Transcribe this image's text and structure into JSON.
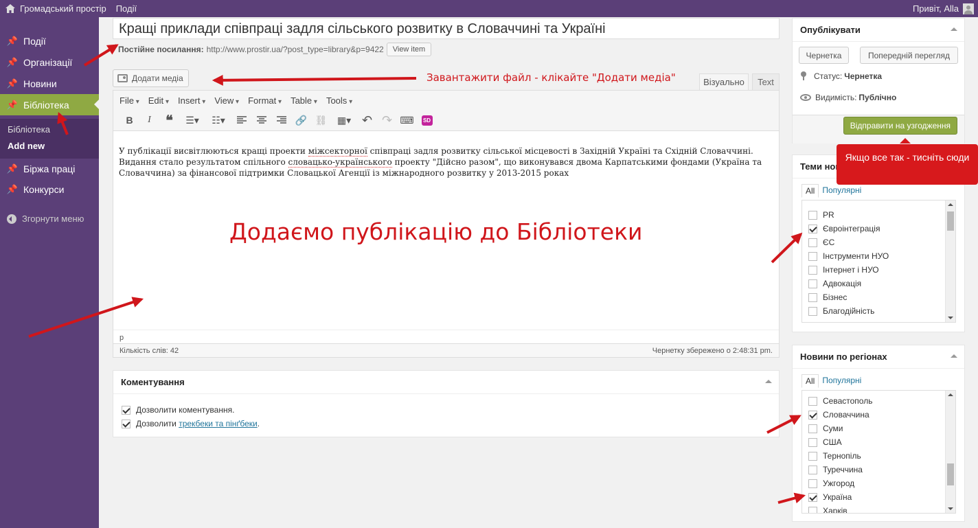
{
  "admin_bar": {
    "site_name": "Громадський простір",
    "menu_item": "Події",
    "greeting": "Привіт, Alla"
  },
  "sidebar": {
    "items": [
      {
        "label": "Події"
      },
      {
        "label": "Організації"
      },
      {
        "label": "Новини"
      },
      {
        "label": "Бібліотека"
      },
      {
        "label": "Біржа праці"
      },
      {
        "label": "Конкурси"
      }
    ],
    "submenu": [
      {
        "label": "Бібліотека"
      },
      {
        "label": "Add new"
      }
    ],
    "collapse_label": "Згорнути меню"
  },
  "post": {
    "title": "Кращі приклади співпраці задля сільського розвитку в Словаччині та Україні",
    "permalink_label": "Постійне посилання:",
    "permalink_url": "http://www.prostir.ua/?post_type=library&p=9422",
    "view_button": "View item"
  },
  "editor": {
    "add_media": "Додати медіа",
    "tab_visual": "Візуально",
    "tab_text": "Text",
    "menus": [
      "File",
      "Edit",
      "Insert",
      "View",
      "Format",
      "Table",
      "Tools"
    ],
    "content_1": "У публікації висвітлюються кращі проекти ",
    "content_misspell_1": "міжсекторної",
    "content_2": " співпраці задля розвитку сільської місцевості в Західній Україні та Східній Словаччині. Видання стало результатом спільного ",
    "content_misspell_2": "словацько-українського",
    "content_3": " проекту \"Дійсно разом\", що виконувався двома Карпатськими фондами (Україна та Словаччина) за фінансової підтримки Словацької Агенції із міжнародного розвитку у 2013-2015 роках",
    "path": "p",
    "word_count": "Кількість слів: 42",
    "draft_saved": "Чернетку збережено о 2:48:31 pm."
  },
  "comments_box": {
    "title": "Коментування",
    "allow_comments": "Дозволити коментування.",
    "allow_pings_prefix": "Дозволити ",
    "allow_pings_link": "трекбеки та пінґбеки",
    "allow_pings_suffix": "."
  },
  "publish_box": {
    "title": "Опублікувати",
    "save_draft": "Чернетка",
    "preview": "Попередній перегляд",
    "status_label": "Статус:",
    "status_value": "Чернетка",
    "visibility_label": "Видимість:",
    "visibility_value": "Публічно",
    "submit": "Відправити на узгодження"
  },
  "topics_box": {
    "title": "Теми новин",
    "tab_all": "All",
    "tab_popular": "Популярні",
    "items": [
      {
        "label": "PR",
        "checked": false
      },
      {
        "label": "Євроінтеграція",
        "checked": true
      },
      {
        "label": "ЄС",
        "checked": false
      },
      {
        "label": "Інструменти НУО",
        "checked": false
      },
      {
        "label": "Інтернет і НУО",
        "checked": false
      },
      {
        "label": "Адвокація",
        "checked": false
      },
      {
        "label": "Бізнес",
        "checked": false
      },
      {
        "label": "Благодійність",
        "checked": false
      }
    ]
  },
  "regions_box": {
    "title": "Новини по регіонах",
    "tab_all": "All",
    "tab_popular": "Популярні",
    "items": [
      {
        "label": "Севастополь",
        "checked": false
      },
      {
        "label": "Словаччина",
        "checked": true
      },
      {
        "label": "Суми",
        "checked": false
      },
      {
        "label": "США",
        "checked": false
      },
      {
        "label": "Тернопіль",
        "checked": false
      },
      {
        "label": "Туреччина",
        "checked": false
      },
      {
        "label": "Ужгород",
        "checked": false
      },
      {
        "label": "Україна",
        "checked": true
      },
      {
        "label": "Харків",
        "checked": false
      }
    ]
  },
  "annotations": {
    "upload_hint": "Завантажити файл - клікайте \"Додати медіа\"",
    "big_caption": "Додаємо публікацію до Бібліотеки",
    "submit_hint": "Якщо все так - тисніть сюди"
  },
  "colors": {
    "admin_purple": "#5b3f78",
    "active_green": "#8fa943",
    "annotation_red": "#d0161b"
  }
}
